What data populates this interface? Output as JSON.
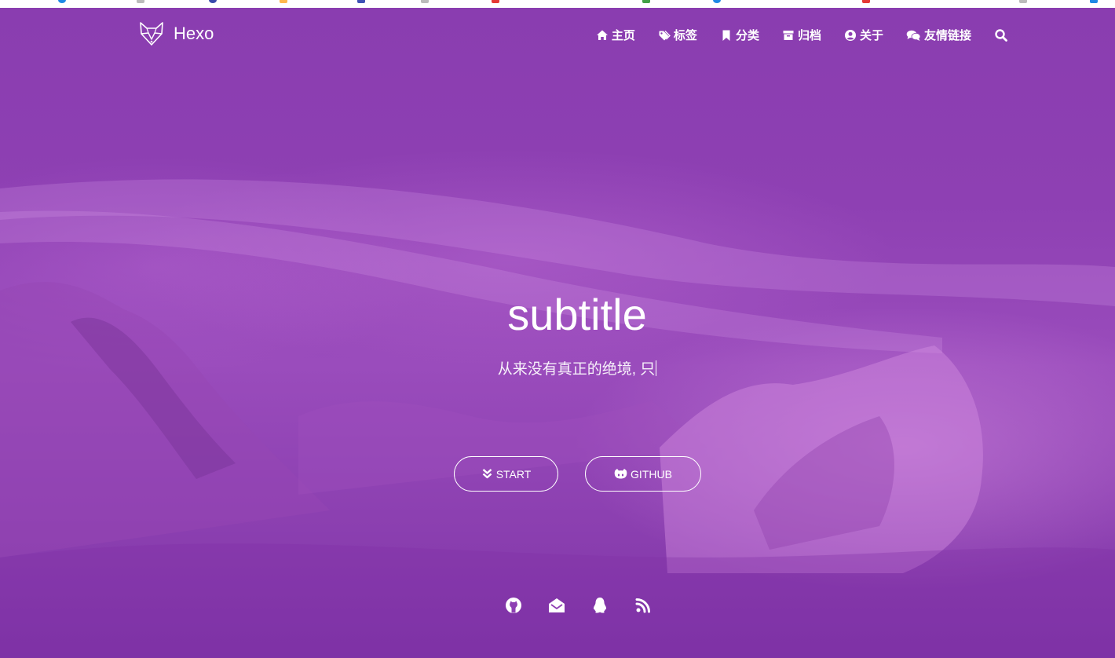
{
  "brand": {
    "name": "Hexo"
  },
  "nav": {
    "items": [
      {
        "label": "主页",
        "icon": "home-icon"
      },
      {
        "label": "标签",
        "icon": "tags-icon"
      },
      {
        "label": "分类",
        "icon": "bookmark-icon"
      },
      {
        "label": "归档",
        "icon": "archive-icon"
      },
      {
        "label": "关于",
        "icon": "user-circle-icon"
      },
      {
        "label": "友情链接",
        "icon": "comments-icon"
      }
    ],
    "search_icon": "search-icon"
  },
  "hero": {
    "title": "subtitle",
    "subtitle": "从来没有真正的绝境, 只"
  },
  "buttons": {
    "start_label": "START",
    "github_label": "GITHUB"
  },
  "social": [
    "github-icon",
    "email-icon",
    "qq-icon",
    "rss-icon"
  ],
  "colors": {
    "background": "#8a3db0",
    "text": "#ffffff"
  }
}
